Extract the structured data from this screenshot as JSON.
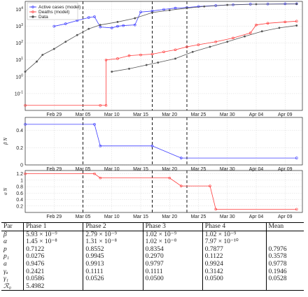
{
  "chart_data": [
    {
      "type": "line",
      "yscale": "log",
      "ylim": [
        0.01,
        30000
      ],
      "xlim": [
        "2020-02-24",
        "2020-04-12"
      ],
      "x_ticks": [
        "Feb 29",
        "Mar 05",
        "Mar 10",
        "Mar 15",
        "Mar 20",
        "Mar 25",
        "Mar 30",
        "Apr 04",
        "Apr 09"
      ],
      "y_ticks": [
        "10^-1",
        "10^0",
        "10^1",
        "10^2",
        "10^3",
        "10^4"
      ],
      "phase_boundaries": [
        "2020-03-05",
        "2020-03-17",
        "2020-03-23"
      ],
      "legend_position": "top-left",
      "grid": true,
      "series": [
        {
          "name": "Active cases (model)",
          "color": "#3b3bff",
          "points": [
            [
              "2020-02-29",
              1000
            ],
            [
              "2020-03-02",
              1400
            ],
            [
              "2020-03-04",
              2200
            ],
            [
              "2020-03-06",
              3300
            ],
            [
              "2020-03-07",
              3700
            ],
            [
              "2020-03-08",
              900
            ],
            [
              "2020-03-10",
              800
            ],
            [
              "2020-03-11",
              1000
            ],
            [
              "2020-03-12",
              1100
            ],
            [
              "2020-03-14",
              1200
            ],
            [
              "2020-03-15",
              7000
            ],
            [
              "2020-03-17",
              8000
            ],
            [
              "2020-03-19",
              10000
            ],
            [
              "2020-03-21",
              12000
            ],
            [
              "2020-03-23",
              13000
            ],
            [
              "2020-03-25",
              15000
            ],
            [
              "2020-03-28",
              17000
            ],
            [
              "2020-03-31",
              19000
            ],
            [
              "2020-04-03",
              20500
            ],
            [
              "2020-04-06",
              21000
            ],
            [
              "2020-04-09",
              21500
            ],
            [
              "2020-04-11",
              21500
            ]
          ]
        },
        {
          "name": "Deaths (model)",
          "color": "#ff3b3b",
          "points": [
            [
              "2020-02-24",
              0.02
            ],
            [
              "2020-03-08",
              0.02
            ],
            [
              "2020-03-09",
              0.02
            ],
            [
              "2020-03-09",
              10
            ],
            [
              "2020-03-11",
              12
            ],
            [
              "2020-03-13",
              18
            ],
            [
              "2020-03-15",
              20
            ],
            [
              "2020-03-17",
              22
            ],
            [
              "2020-03-19",
              30
            ],
            [
              "2020-03-21",
              40
            ],
            [
              "2020-03-23",
              60
            ],
            [
              "2020-03-25",
              80
            ],
            [
              "2020-03-28",
              120
            ],
            [
              "2020-03-31",
              200
            ],
            [
              "2020-04-03",
              400
            ],
            [
              "2020-04-04",
              1200
            ],
            [
              "2020-04-06",
              1500
            ],
            [
              "2020-04-09",
              1800
            ],
            [
              "2020-04-11",
              2000
            ]
          ]
        },
        {
          "name": "Data",
          "color": "#555555",
          "points": [
            [
              "2020-02-24",
              2
            ],
            [
              "2020-02-26",
              8
            ],
            [
              "2020-02-27",
              20
            ],
            [
              "2020-02-29",
              45
            ],
            [
              "2020-03-02",
              120
            ],
            [
              "2020-03-04",
              300
            ],
            [
              "2020-03-06",
              700
            ],
            [
              "2020-03-08",
              1200
            ],
            [
              "2020-03-11",
              1800
            ],
            [
              "2020-03-14",
              3000
            ],
            [
              "2020-03-17",
              6500
            ],
            [
              "2020-03-20",
              9000
            ],
            [
              "2020-03-23",
              12000
            ],
            [
              "2020-03-26",
              15000
            ],
            [
              "2020-03-30",
              18500
            ],
            [
              "2020-04-04",
              20500
            ],
            [
              "2020-04-11",
              21000
            ],
            [
              "2020-03-10",
              2
            ],
            [
              "2020-03-13",
              3
            ],
            [
              "2020-03-16",
              5
            ],
            [
              "2020-03-18",
              7
            ],
            [
              "2020-03-21",
              12
            ],
            [
              "2020-03-24",
              30
            ],
            [
              "2020-03-27",
              60
            ],
            [
              "2020-03-30",
              120
            ],
            [
              "2020-04-02",
              250
            ],
            [
              "2020-04-05",
              500
            ],
            [
              "2020-04-08",
              800
            ],
            [
              "2020-04-11",
              1100
            ]
          ]
        }
      ]
    },
    {
      "type": "line",
      "ylabel": "β N",
      "ylim": [
        0,
        0.55
      ],
      "y_ticks": [
        0,
        0.2,
        0.4
      ],
      "series": [
        {
          "name": "",
          "color": "#3b3bff",
          "points": [
            [
              "2020-02-24",
              0.47
            ],
            [
              "2020-03-07",
              0.47
            ],
            [
              "2020-03-08",
              0.22
            ],
            [
              "2020-03-17",
              0.22
            ],
            [
              "2020-03-22",
              0.08
            ],
            [
              "2020-04-11",
              0.08
            ]
          ]
        }
      ]
    },
    {
      "type": "line",
      "ylabel": "α N",
      "ylim": [
        0,
        1.3
      ],
      "y_ticks": [
        0.2,
        0.4,
        0.6,
        0.8,
        1,
        1.2
      ],
      "series": [
        {
          "name": "",
          "color": "#ff3b3b",
          "points": [
            [
              "2020-02-24",
              1.2
            ],
            [
              "2020-03-07",
              1.2
            ],
            [
              "2020-03-08",
              1.07
            ],
            [
              "2020-03-20",
              1.07
            ],
            [
              "2020-03-22",
              0.82
            ],
            [
              "2020-03-27",
              0.82
            ],
            [
              "2020-03-28",
              0.1
            ],
            [
              "2020-04-11",
              0.1
            ]
          ]
        }
      ]
    }
  ],
  "table": {
    "headers": [
      "Par",
      "Phase 1",
      "Phase 2",
      "Phase 3",
      "Phase 4",
      "Mean"
    ],
    "rows": [
      [
        "β",
        "5.93 × 10⁻⁹",
        "2.79 × 10⁻⁹",
        "1.02 × 10⁻⁹",
        "1.02 × 10⁻⁹",
        ""
      ],
      [
        "α",
        "1.45 × 10⁻⁸",
        "1.31 × 10⁻⁸",
        "1.02 × 10⁻⁸",
        "7.97 × 10⁻¹⁰",
        ""
      ],
      [
        "p",
        "0.7122",
        "0.8552",
        "0.8354",
        "0.7877",
        "0.7976"
      ],
      [
        "p₁",
        "0.0276",
        "0.9945",
        "0.2970",
        "0.1122",
        "0.3578"
      ],
      [
        "a",
        "0.9476",
        "0.9913",
        "0.9797",
        "0.9924",
        "0.9778"
      ],
      [
        "γₐ",
        "0.2421",
        "0.1111",
        "0.1111",
        "0.3142",
        "0.1946"
      ],
      [
        "γ₁",
        "0.0586",
        "0.0526",
        "0.0500",
        "0.0500",
        "0.0528"
      ],
      [
        "ℛ₀",
        "5.4982",
        "",
        "",
        "",
        ""
      ]
    ]
  }
}
